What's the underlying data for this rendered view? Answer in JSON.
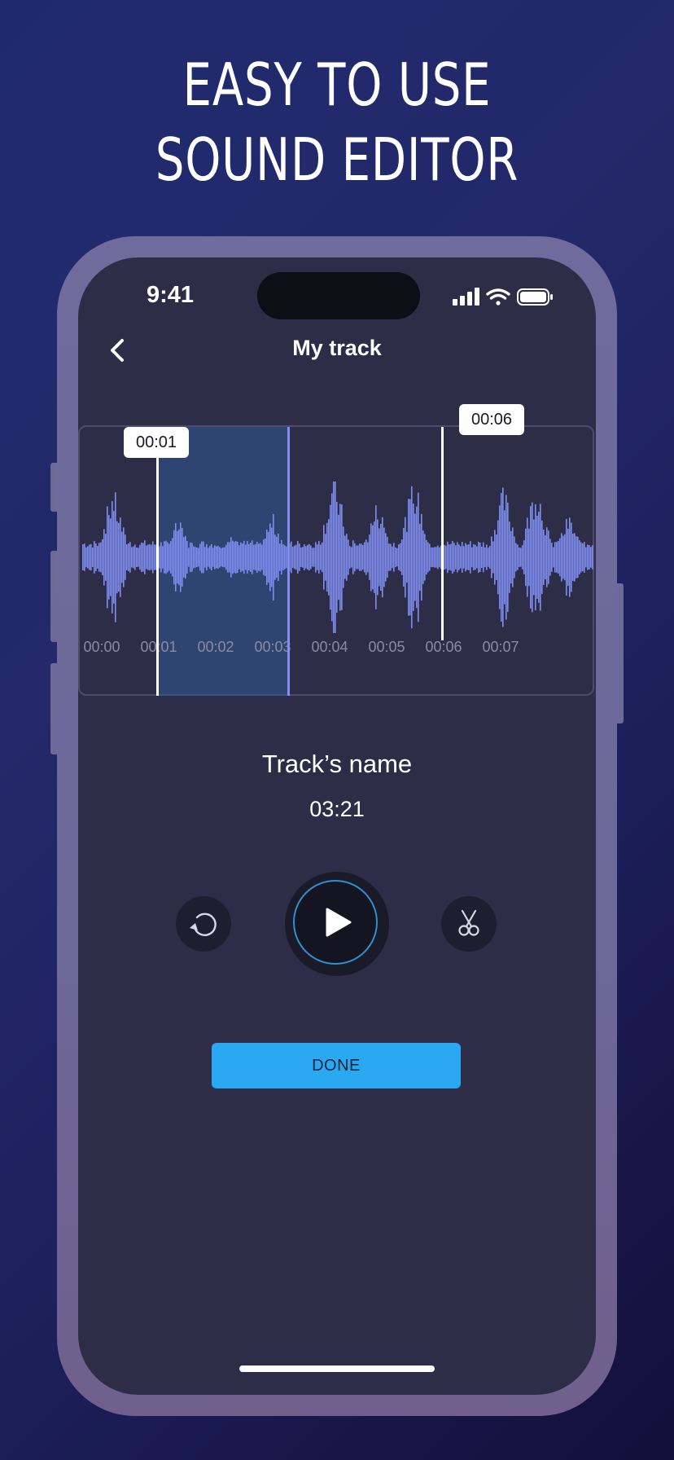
{
  "headline": {
    "line1": "EASY TO USE",
    "line2": "SOUND EDITOR"
  },
  "status_bar": {
    "time": "9:41"
  },
  "nav": {
    "title": "My track",
    "back_icon": "chevron-left-icon"
  },
  "waveform": {
    "start_marker": "00:01",
    "end_marker": "00:06",
    "timeline": [
      "00:00",
      "00:01",
      "00:02",
      "00:03",
      "00:04",
      "00:05",
      "00:06",
      "00:07"
    ],
    "colors": {
      "wave": "#7f8ef0",
      "selection": "#2f5a94",
      "playhead": "#7f8ef0",
      "marker": "#ffffff"
    }
  },
  "track": {
    "name": "Track’s name",
    "duration": "03:21"
  },
  "controls": {
    "reset_icon": "undo-icon",
    "play_icon": "play-icon",
    "cut_icon": "scissors-icon"
  },
  "done": {
    "label": "DONE",
    "color": "#2ba8f2"
  }
}
